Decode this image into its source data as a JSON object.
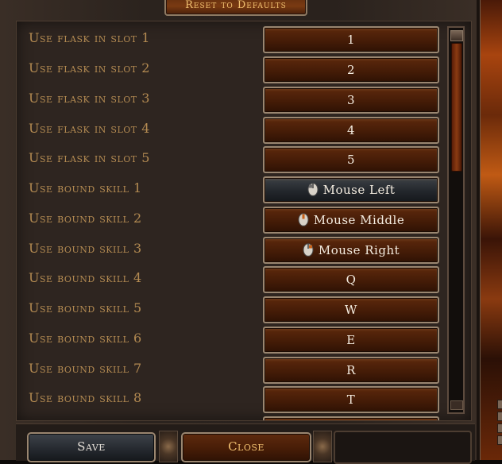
{
  "header": {
    "reset_label": "Reset to Defaults"
  },
  "bindings": [
    {
      "action": "Use flask in slot 1",
      "key": "1"
    },
    {
      "action": "Use flask in slot 2",
      "key": "2"
    },
    {
      "action": "Use flask in slot 3",
      "key": "3"
    },
    {
      "action": "Use flask in slot 4",
      "key": "4"
    },
    {
      "action": "Use flask in slot 5",
      "key": "5"
    },
    {
      "action": "Use bound skill 1",
      "key": "Mouse Left",
      "icon": "mouse-icon"
    },
    {
      "action": "Use bound skill 2",
      "key": "Mouse Middle",
      "icon": "mouse-icon"
    },
    {
      "action": "Use bound skill 3",
      "key": "Mouse Right",
      "icon": "mouse-icon"
    },
    {
      "action": "Use bound skill 4",
      "key": "Q"
    },
    {
      "action": "Use bound skill 5",
      "key": "W"
    },
    {
      "action": "Use bound skill 6",
      "key": "E"
    },
    {
      "action": "Use bound skill 7",
      "key": "R"
    },
    {
      "action": "Use bound skill 8",
      "key": "T"
    }
  ],
  "footer": {
    "save_label": "Save",
    "close_label": "Close"
  },
  "colors": {
    "label": "#b48b52",
    "key_text": "#f4ece0",
    "close_text": "#f2c070"
  }
}
